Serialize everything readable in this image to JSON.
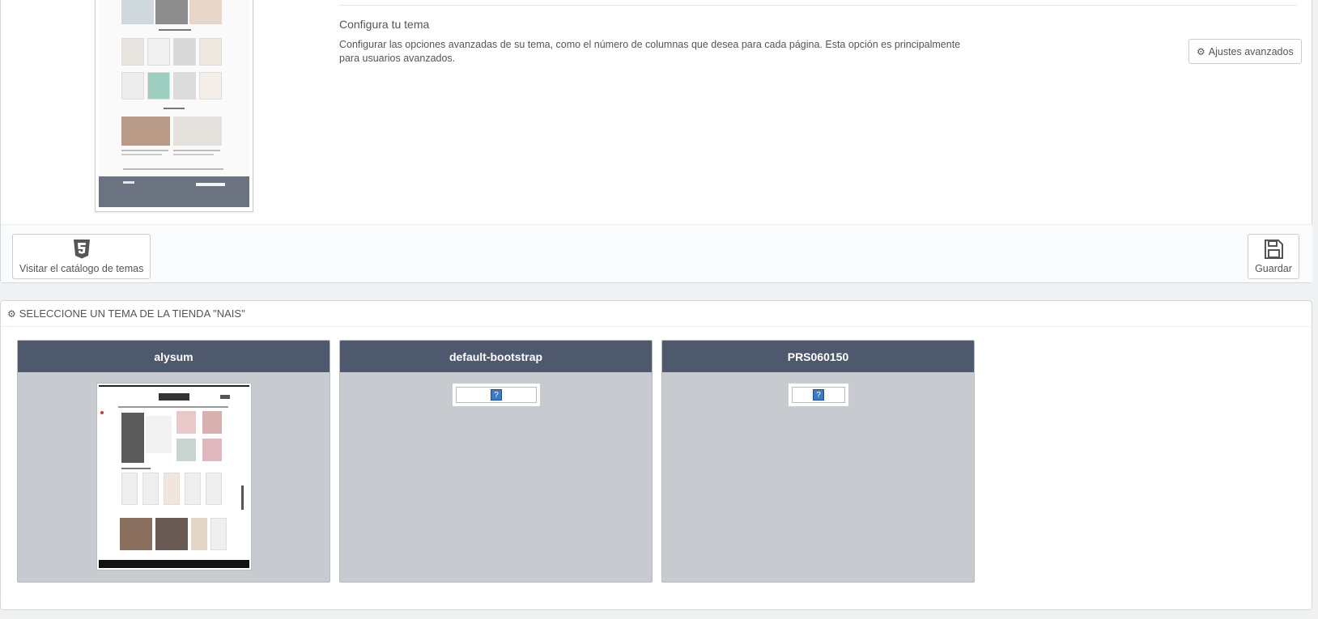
{
  "config": {
    "title": "Configura tu tema",
    "description": "Configurar las opciones avanzadas de su tema, como el número de columnas que desea para cada página. Esta opción es principalmente para usuarios avanzados.",
    "advanced_button_label": "Ajustes avanzados",
    "advanced_button_icon": "gear-icon"
  },
  "actions": {
    "catalog_label": "Visitar el catálogo de temas",
    "catalog_icon": "html5-icon",
    "save_label": "Guardar",
    "save_icon": "floppy-disk-icon"
  },
  "theme_panel": {
    "heading": "SELECCIONE UN TEMA DE LA TIENDA \"NAIS\"",
    "heading_icon": "cogs-icon",
    "themes": [
      {
        "name": "alysum",
        "preview": "screenshot"
      },
      {
        "name": "default-bootstrap",
        "preview": "broken-image"
      },
      {
        "name": "PRS060150",
        "preview": "broken-image"
      }
    ]
  },
  "colors": {
    "card_header": "#4f596e",
    "card_body": "#c7cace",
    "page_bg": "#eff1f2"
  }
}
